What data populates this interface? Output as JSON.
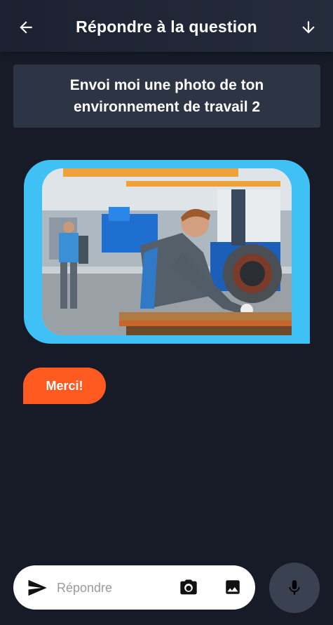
{
  "header": {
    "title": "Répondre à la question",
    "back_icon": "arrow-left-icon",
    "down_icon": "arrow-down-icon"
  },
  "question": {
    "text": "Envoi moi une photo de ton environnement de travail 2"
  },
  "photo_message": {
    "bubble_color": "#3fc1f5"
  },
  "reply_chip": {
    "label": "Merci!",
    "color": "#ff5a1f"
  },
  "composer": {
    "placeholder": "Répondre",
    "send_icon": "send-icon",
    "camera_icon": "camera-icon",
    "gallery_icon": "image-icon",
    "mic_icon": "microphone-icon"
  },
  "colors": {
    "background": "#161b27",
    "card": "#2d3443",
    "mic_button": "#3a4150"
  }
}
